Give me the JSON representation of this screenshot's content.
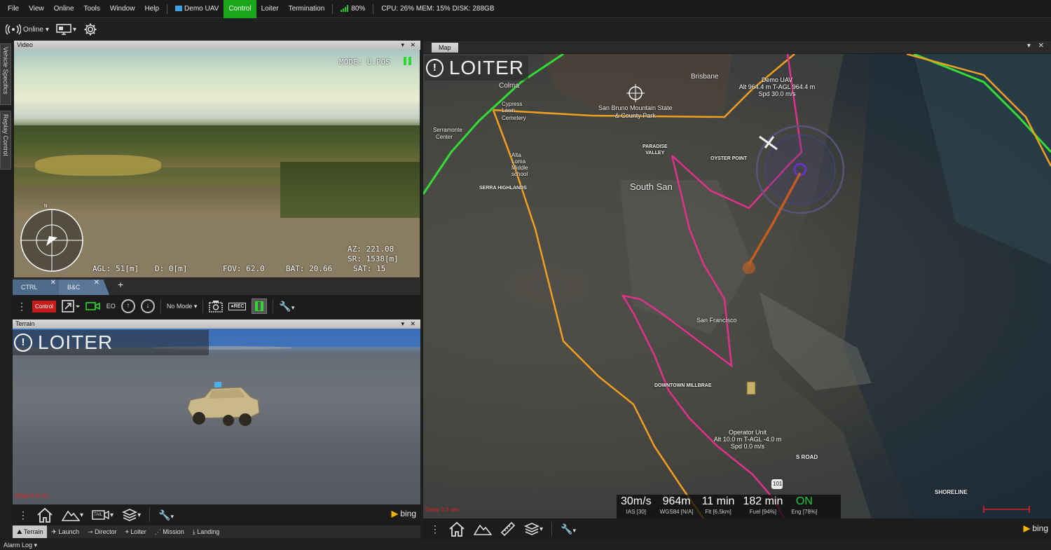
{
  "menubar": {
    "items": [
      "File",
      "View",
      "Online",
      "Tools",
      "Window",
      "Help"
    ],
    "vehicle": "Demo UAV",
    "modes": [
      "Control",
      "Loiter",
      "Termination"
    ],
    "active_mode": "Control",
    "link_quality": "80%",
    "system_stats": "CPU: 26% MEM: 15% DISK: 288GB"
  },
  "toolbar": {
    "online_label": "Online"
  },
  "side_tabs": [
    "Vehicle Specifics",
    "Replay Control"
  ],
  "video_panel": {
    "title": "Video",
    "hud": {
      "mode": "MODE: U.POS",
      "az": "AZ: 221.08",
      "sr": "SR: 1538[m]",
      "agl": "AGL: 51[m]",
      "d": "D: 0[m]",
      "fov": "FOV: 62.0",
      "bat": "BAT: 20.66",
      "sat": "SAT: 15",
      "compass_north": "N"
    },
    "tabs": [
      "CTRL",
      "B&C"
    ],
    "add_tab": "+",
    "controls": {
      "control_label": "Control",
      "eo_label": "EO",
      "mode_select": "No Mode",
      "rec_label": "REC"
    }
  },
  "terrain_panel": {
    "title": "Terrain",
    "mode": "LOITER",
    "delay": "Delay 0.3 sec",
    "camera_btn_label": "TAIL",
    "tabs": [
      "Terrain",
      "Launch",
      "Director",
      "Loiter",
      "Mission",
      "Landing"
    ],
    "selected_tab": "Terrain"
  },
  "map_panel": {
    "title": "Map",
    "mode": "LOITER",
    "delay": "Delay 0.3 sec",
    "labels": {
      "brisbane": "Brisbane",
      "colma": "Colma",
      "cypress": "Cypress",
      "lawn": "Lawn",
      "cemetery": "Cemetery",
      "serramonte": "Serramonte",
      "center": "Center",
      "alta_loma": "Alta\nLoma\nMiddle\nschool",
      "san_bruno": "San Bruno Mountain State\n& County Park",
      "paradise_valley": "PARADISE\nVALLEY",
      "oyster_point": "OYSTER POINT",
      "south_san": "South San",
      "serra_highlands": "SERRA HIGHLANDS",
      "san_francisco": "San Francisco",
      "downtown_millbrae": "DOWNTOWN MILLBRAE",
      "s_road": "S ROAD",
      "shoreline": "SHORELINE",
      "hwy_101": "101"
    },
    "demo_uav": {
      "name": "Demo UAV",
      "alt": "Alt 964.4 m T-AGL 964.4 m",
      "spd": "Spd 30.0 m/s"
    },
    "operator": {
      "name": "Operator Unit",
      "alt": "Alt 10.0 m T-AGL -4.0 m",
      "spd": "Spd 0.0 m/s"
    },
    "telemetry": [
      {
        "value": "30m/s",
        "sub": "IAS [30]"
      },
      {
        "value": "964m",
        "sub": "WGS84 [N/A]"
      },
      {
        "value": "11 min",
        "sub": "Flt [6.5km]"
      },
      {
        "value": "182 min",
        "sub": "Fuel [94%]"
      },
      {
        "value": "ON",
        "sub": "Eng [78%]"
      }
    ],
    "route_colors": {
      "route": "#e0328c",
      "track": "#f0a020",
      "boundary": "#33dd33",
      "link": "#d8601a"
    }
  },
  "bing": "bing",
  "alarm_log": "Alarm Log"
}
